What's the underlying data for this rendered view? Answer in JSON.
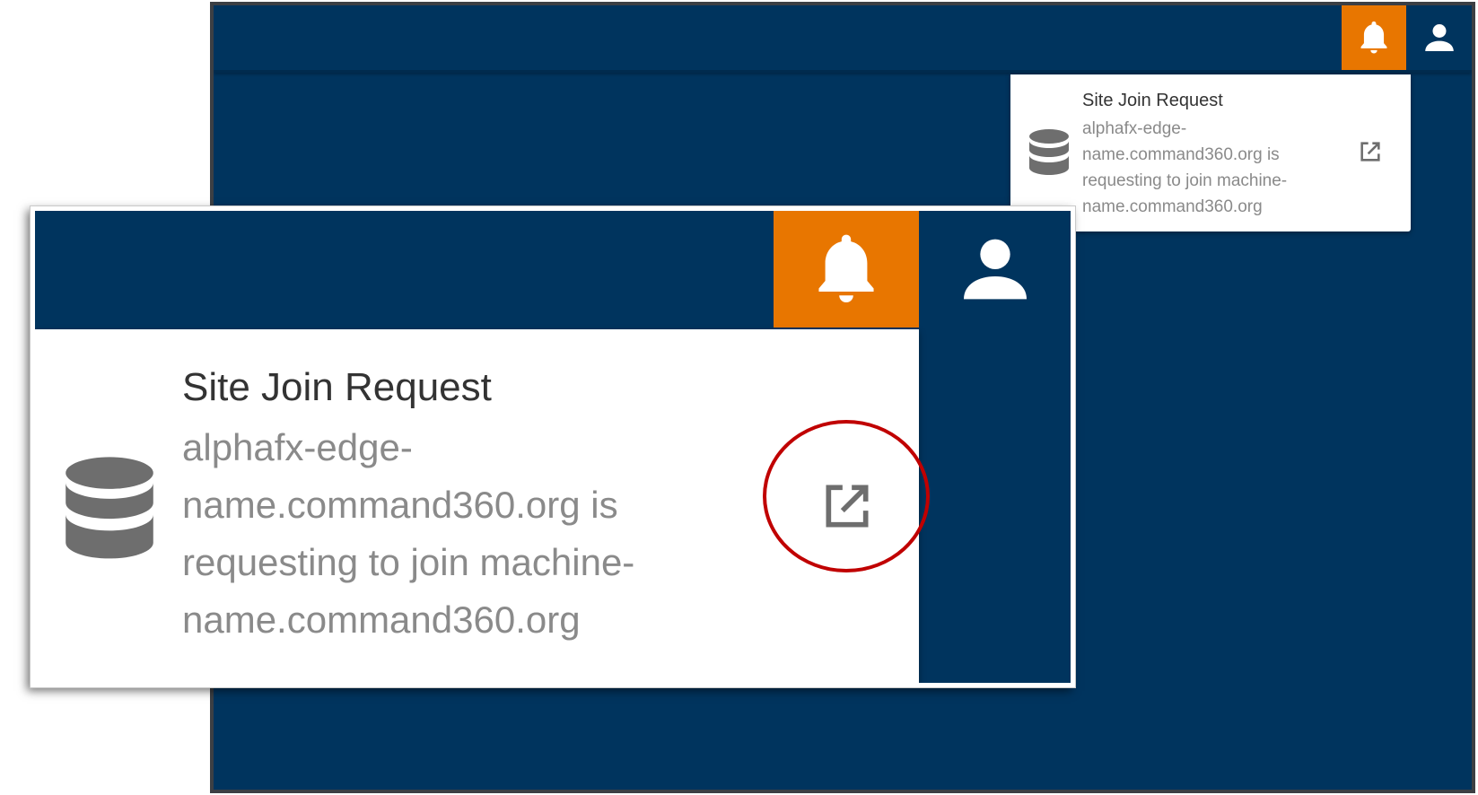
{
  "notification": {
    "title": "Site Join Request",
    "message": "alphafx-edge-name.command360.org is requesting to join machine-name.command360.org"
  },
  "icons": {
    "bell": "bell-icon",
    "user": "user-icon",
    "database": "database-icon",
    "open_external": "open-external-icon"
  },
  "colors": {
    "topbar": "#00345e",
    "bell_active": "#e87600",
    "highlight": "#c00000",
    "title_text": "#333333",
    "message_text": "#8a8a8a"
  }
}
